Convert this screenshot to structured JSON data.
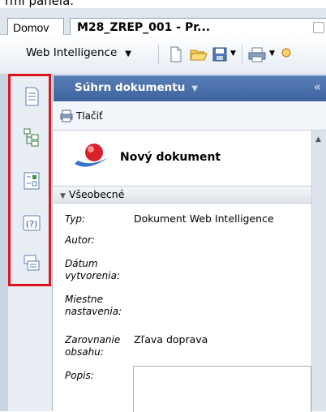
{
  "top_caption": "rmi panela.",
  "tabs": {
    "home": "Domov",
    "document": "M28_ZREP_001 - Pr..."
  },
  "toolbar": {
    "app_menu": "Web Intelligence"
  },
  "panel": {
    "title": "Súhrn dokumentu",
    "print": "Tlačiť",
    "doc_name": "Nový dokument",
    "section": "Všeobecné"
  },
  "fields": {
    "type_label": "Typ:",
    "type_value": "Dokument Web Intelligence",
    "author_label": "Autor:",
    "created_label_1": "Dátum",
    "created_label_2": "vytvorenia:",
    "locale_label_1": "Miestne",
    "locale_label_2": "nastavenia:",
    "align_label_1": "Zarovnanie",
    "align_label_2": "obsahu:",
    "align_value": "Zľava doprava",
    "description_label": "Popis:"
  },
  "colors": {
    "highlight": "#e0141c",
    "panel_header": "#4a6ea8"
  }
}
